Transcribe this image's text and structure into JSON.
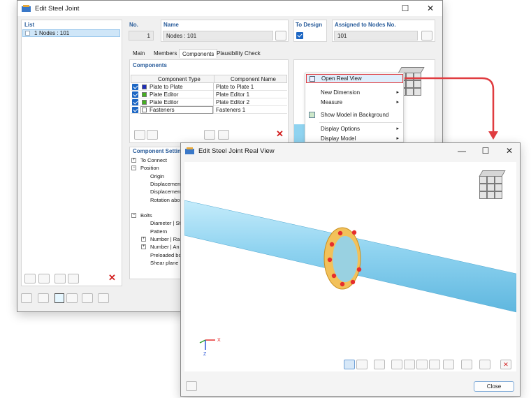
{
  "window1": {
    "title": "Edit Steel Joint",
    "list_label": "List",
    "list_items": [
      {
        "num": "1",
        "label": "Nodes : 101"
      }
    ],
    "no_label": "No.",
    "no_value": "1",
    "name_label": "Name",
    "name_value": "Nodes : 101",
    "to_design_label": "To Design",
    "assigned_label": "Assigned to Nodes No.",
    "assigned_value": "101",
    "tabs": [
      "Main",
      "Members",
      "Components",
      "Plausibility Check"
    ],
    "components_label": "Components",
    "table_headers": [
      "Component Type",
      "Component Name"
    ],
    "components": [
      {
        "type": "Plate to Plate",
        "name": "Plate to Plate 1",
        "color": "#1f2fb8",
        "checked": true
      },
      {
        "type": "Plate Editor",
        "name": "Plate Editor 1",
        "color": "#45b020",
        "checked": true
      },
      {
        "type": "Plate Editor",
        "name": "Plate Editor 2",
        "color": "#45b020",
        "checked": true
      },
      {
        "type": "Fasteners",
        "name": "Fasteners 1",
        "color": "#ffffff",
        "checked": true
      }
    ],
    "settings_label": "Component Settin",
    "tree": [
      {
        "text": "To Connect",
        "indent": 0,
        "toggle": "+"
      },
      {
        "text": "Position",
        "indent": 0,
        "toggle": "-"
      },
      {
        "text": "Origin",
        "indent": 2,
        "toggle": ""
      },
      {
        "text": "Displacemen",
        "indent": 2,
        "toggle": ""
      },
      {
        "text": "Displacemen",
        "indent": 2,
        "toggle": ""
      },
      {
        "text": "Rotation abo",
        "indent": 2,
        "toggle": ""
      },
      {
        "text": "",
        "indent": 0,
        "toggle": ""
      },
      {
        "text": "Bolts",
        "indent": 0,
        "toggle": "-"
      },
      {
        "text": "Diameter | St",
        "indent": 2,
        "toggle": ""
      },
      {
        "text": "Pattern",
        "indent": 2,
        "toggle": ""
      },
      {
        "text": "Number | Ra",
        "indent": 2,
        "toggle": "+"
      },
      {
        "text": "Number | An",
        "indent": 2,
        "toggle": "+"
      },
      {
        "text": "Preloaded bo",
        "indent": 2,
        "toggle": ""
      },
      {
        "text": "Shear plane i",
        "indent": 2,
        "toggle": ""
      }
    ]
  },
  "context_menu": {
    "items": [
      {
        "label": "Open Real View",
        "arrow": false
      },
      {
        "label": "New Dimension",
        "arrow": true
      },
      {
        "label": "Measure",
        "arrow": true
      },
      {
        "label": "Show Model in Background",
        "arrow": false
      },
      {
        "label": "Display Options",
        "arrow": true
      },
      {
        "label": "Display Model",
        "arrow": true
      }
    ]
  },
  "window2": {
    "title": "Edit Steel Joint Real View",
    "close_label": "Close",
    "axes": {
      "x": "X",
      "z": "Z"
    }
  },
  "colors": {
    "accent": "#1d67c4",
    "pipe": "#8fd3f0",
    "flange": "#f2c15a",
    "bolt": "#e52d2d",
    "callout_arrow": "#e03c40"
  }
}
